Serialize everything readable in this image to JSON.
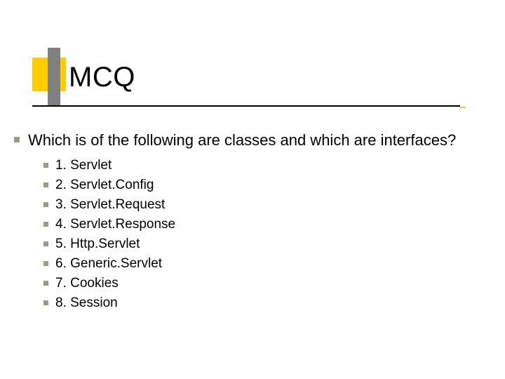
{
  "title": "MCQ",
  "body": {
    "question": "Which is of the following are classes and which are interfaces?",
    "items": [
      "1. Servlet",
      "2. Servlet.Config",
      "3. Servlet.Request",
      "4. Servlet.Response",
      "5. Http.Servlet",
      "6. Generic.Servlet",
      "7. Cookies",
      "8. Session"
    ]
  }
}
